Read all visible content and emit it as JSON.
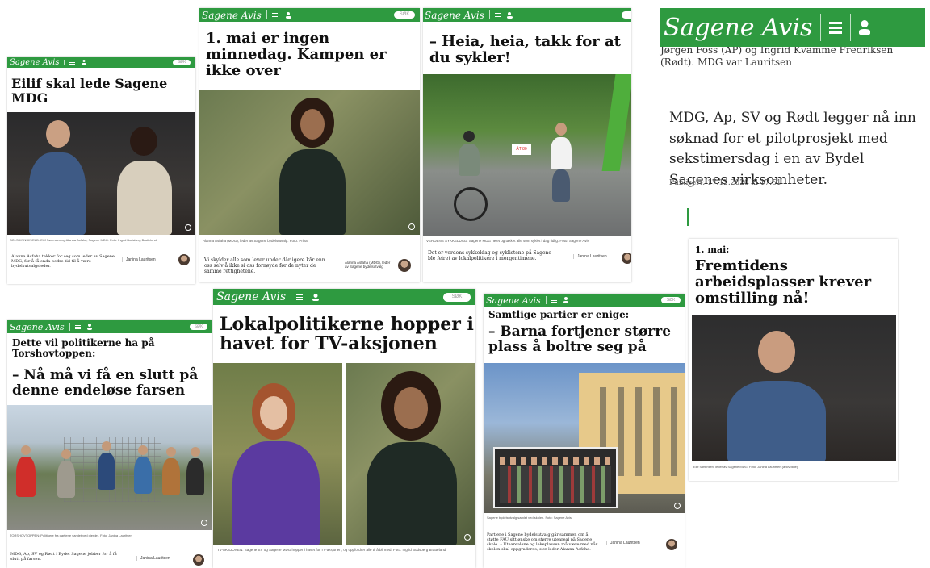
{
  "brand": {
    "name": "Sagene Avis",
    "green": "#2e9a40",
    "search": "SØK"
  },
  "cards": {
    "c1": {
      "headline": "Eilif skal lede Sagene MDG",
      "caption": "SOLSKINNSKVELD: Eilif Sørensen og Alanna Asfaha, Sagene MDG. Foto: Ingrid Bodsberg Bratteland",
      "lead": "Alanna Asfaha takker for seg som leder av Sagene MDG, for å få enda bedre tid til å være bydelsutvalgsleder.",
      "author": "Janina Lauritsen"
    },
    "c2": {
      "headline": "1. mai er ingen minnedag. Kampen er ikke over",
      "caption": "Alanna Asfaha (MDG), leder av Sagene bydelsutvalg. Foto: Privat",
      "lead": "Vi skylder alle som lever under dårligere kår enn oss selv å ikke si oss fornøyde før de nyter de samme rettighetene.",
      "author": "Alanna Asfaha (MDG), leder av Sagene bydelsutvalg"
    },
    "c3": {
      "headline": "– Heia, heia, takk for at du sykler!",
      "sign": "ÅT 80",
      "caption": "VERDENS SYKKELDAG: Sagene MDG heiet og takket alle som syklet i dag tidlig. Foto: Sagene Avis",
      "lead": "Det er verdens sykkeldag og syklistene på Sagene ble feiret av lokalpolitikere i morgentimene.",
      "author": "Janina Lauritsen"
    },
    "c4": {
      "top": "Jørgen Foss (AP) og Ingrid Kvamme Fredriksen (Rødt). MDG var Lauritsen",
      "body": "MDG, Ap, SV og Rødt legger nå inn søknad for et pilotprosjekt med sekstimersdag i en av Bydel Sagenes virksomheter.",
      "published": "Publisert: 17.12.2020 kl 17:51"
    },
    "c5": {
      "kicker": "1. mai:",
      "headline": "Fremtidens arbeidsplasser krever omstilling nå!",
      "caption": "Eilif Sørensen, leder av Sagene MDG. Foto: Janina Lauritsen (arkivbilde)"
    },
    "c6": {
      "kicker": "Dette vil politikerne ha på Torshovtoppen:",
      "headline": "– Nå må vi få en slutt på denne endeløse farsen",
      "caption": "TORSHOVTOPPEN: Politikere fra partiene samlet ved gjerdet. Foto: Janina Lauritsen",
      "lead": "MDG, Ap, SV og Rødt i Bydel Sagene jobber for å få slutt på farsen.",
      "author": "Janina Lauritsen"
    },
    "c7": {
      "headline": "Lokalpolitikerne hopper i havet for TV-aksjonen",
      "caption": "TV-AKSJONEN: Sagene SV og Sagene MDG hopper i havet for TV-aksjonen, og oppfordrer alle til å bli med. Foto: Ingrid Bodsberg Bratteland"
    },
    "c8": {
      "kicker": "Samtlige partier er enige:",
      "headline": "– Barna fortjener større plass å boltre seg på",
      "caption": "Sagene bydelsutvalg samlet ved skolen. Foto: Sagene Avis",
      "lead": "Partiene i Sagene bydelsutvalg går sammen om å støtte FAU sitt ønske om større uteareal på Sagene skole. – Utearealene og lekeplassen må være med når skolen skal oppgraderes, sier leder Alanna Asfaha.",
      "author": "Janina Lauritsen"
    }
  },
  "colors": {
    "green": "#2e9a40",
    "text": "#111111"
  },
  "icons": [
    "menu-icon",
    "user-icon",
    "search-icon",
    "zoom-icon"
  ]
}
